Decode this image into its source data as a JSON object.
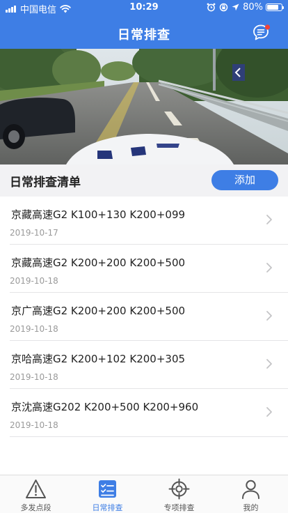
{
  "status_bar": {
    "carrier": "中国电信",
    "time": "10:29",
    "battery": "80%",
    "battery_level": 0.8
  },
  "header": {
    "title": "日常排查",
    "message_icon": "chat-bubble-icon"
  },
  "colors": {
    "brand": "#3e7ee5",
    "notification_dot": "#f0433a",
    "section_background": "#f2f2f4"
  },
  "section": {
    "title": "日常排查清单",
    "add_label": "添加"
  },
  "list": {
    "items": [
      {
        "title": "京藏高速G2  K100+130  K200+099",
        "date": "2019-10-17"
      },
      {
        "title": "京藏高速G2  K200+200  K200+500",
        "date": "2019-10-18"
      },
      {
        "title": "京广高速G2  K200+200  K200+500",
        "date": "2019-10-18"
      },
      {
        "title": "京哈高速G2  K200+102  K200+305",
        "date": "2019-10-18"
      },
      {
        "title": "京沈高速G202  K200+500  K200+960",
        "date": "2019-10-18"
      }
    ]
  },
  "tabs": [
    {
      "label": "多发点段",
      "icon": "warning-triangle-icon",
      "active": false
    },
    {
      "label": "日常排查",
      "icon": "checklist-icon",
      "active": true
    },
    {
      "label": "专项排查",
      "icon": "crosshair-target-icon",
      "active": false
    },
    {
      "label": "我的",
      "icon": "user-profile-icon",
      "active": false
    }
  ]
}
